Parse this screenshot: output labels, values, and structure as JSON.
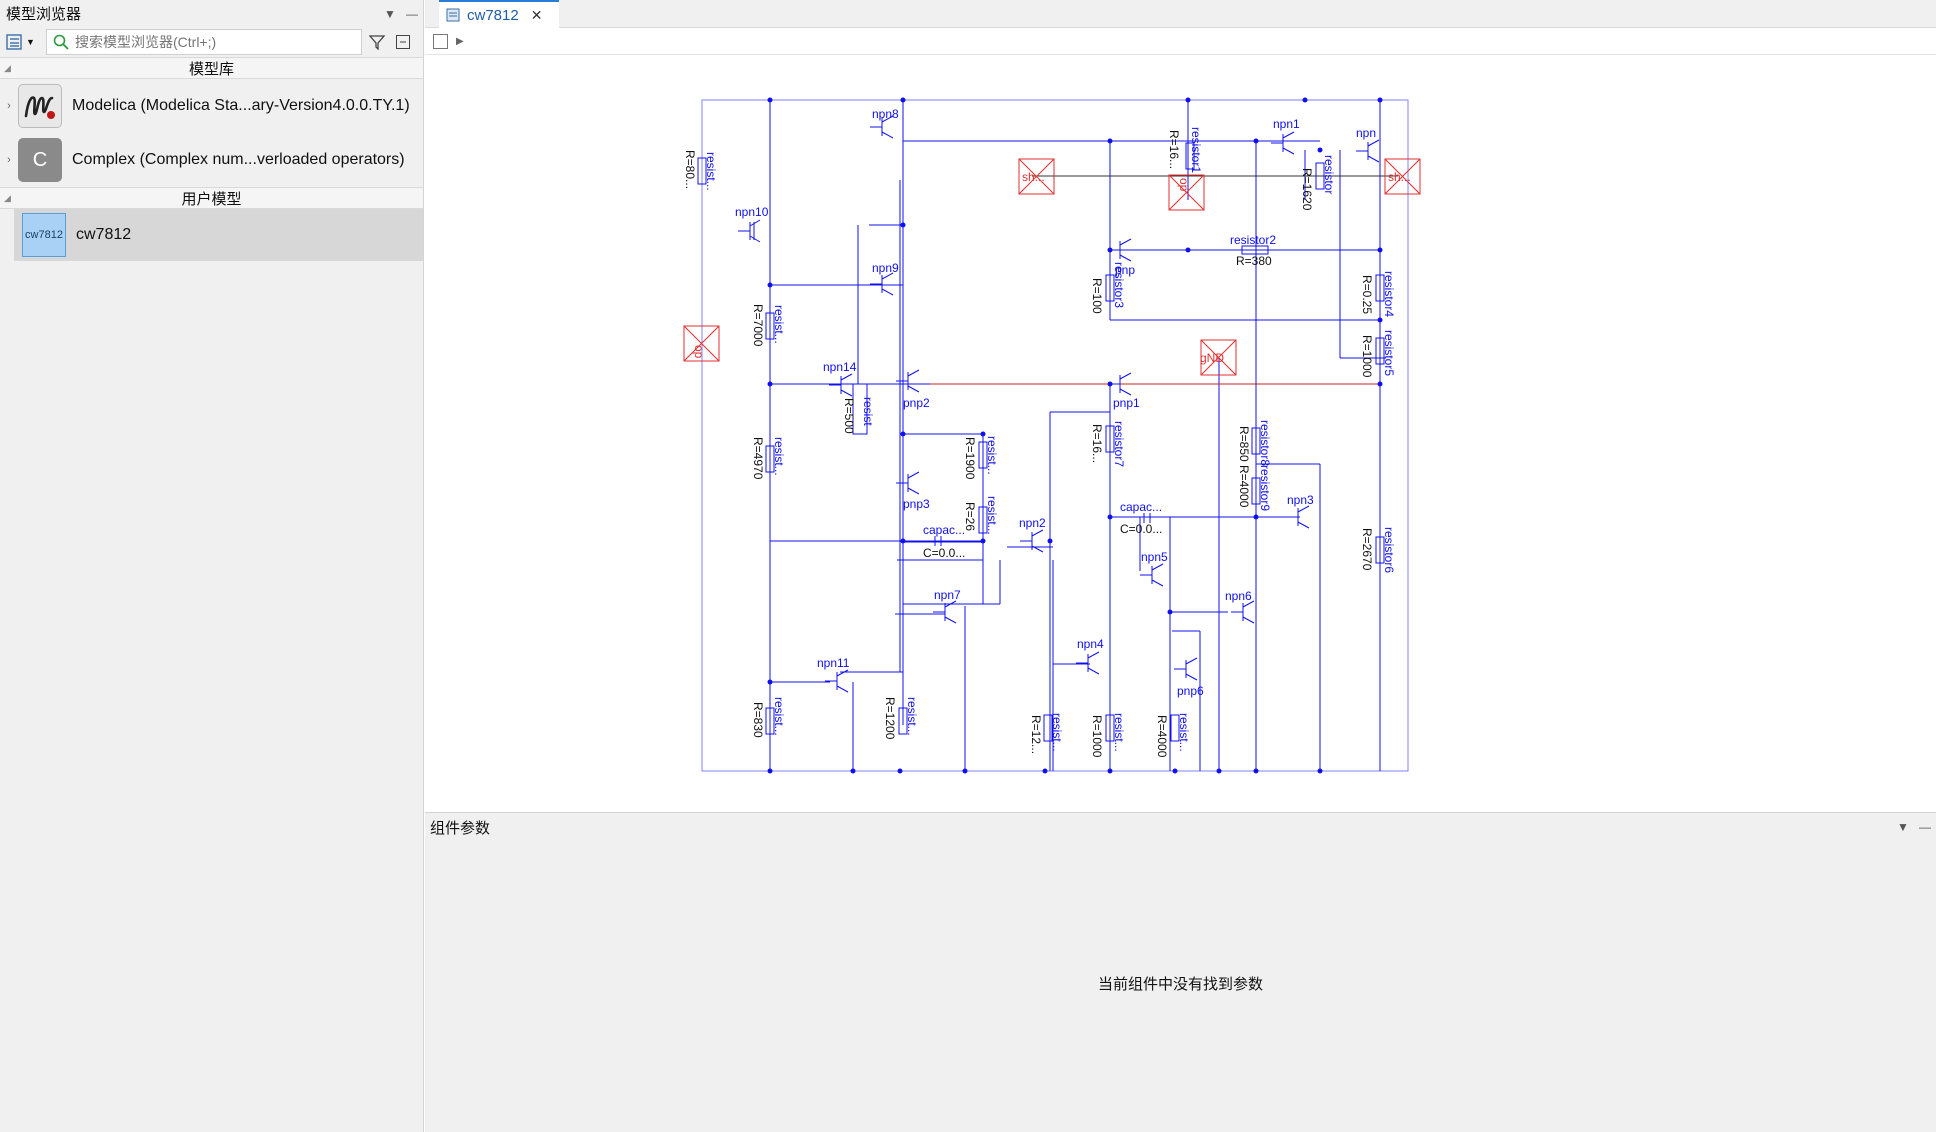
{
  "browser": {
    "title": "模型浏览器",
    "search_placeholder": "搜索模型浏览器(Ctrl+;)",
    "library_section": "模型库",
    "libraries": [
      {
        "icon": "modelica-logo-icon",
        "label": "Modelica (Modelica Sta...ary-Version4.0.0.TY.1)"
      },
      {
        "icon_text": "C",
        "label": "Complex (Complex num...verloaded operators)"
      }
    ],
    "user_section": "用户模型",
    "user_models": [
      {
        "icon_text": "cw7812",
        "label": "cw7812"
      }
    ]
  },
  "tab": {
    "label": "cw7812"
  },
  "params": {
    "title": "组件参数",
    "empty_message": "当前组件中没有找到参数"
  },
  "diagram": {
    "colors": {
      "wire": "#0000ff",
      "component": "#0000cc",
      "connector": "#e03030",
      "border": "#8080ff"
    },
    "labels": {
      "npn8": "npn8",
      "npn10": "npn10",
      "npn9": "npn9",
      "npn14": "npn14",
      "pnp2": "pnp2",
      "pnp3": "pnp3",
      "npn7": "npn7",
      "npn11": "npn11",
      "npn2": "npn2",
      "npn4": "npn4",
      "npn5": "npn5",
      "pnp6": "pnp6",
      "npn6": "npn6",
      "npn3": "npn3",
      "npn1": "npn1",
      "npn": "npn",
      "pnp": "pnp",
      "pnp1": "pnp1",
      "resistor1": "resistor1",
      "resistor2": "resistor2",
      "resistor3": "resistor3",
      "resistor4": "resistor4",
      "resistor5": "resistor5",
      "resistor6": "resistor6",
      "resistor7": "resistor7",
      "resistor8": "resistor8",
      "resistor9": "resistor9",
      "resistor": "resistor",
      "resist": "resist...",
      "resist_short": "resist",
      "capac": "capac...",
      "sh": "sh...",
      "op": "op",
      "gnd": "gND",
      "r80": "R=80...",
      "r16": "R=16...",
      "r1620": "R=1620",
      "r380": "R=380",
      "r100": "R=100",
      "r025": "R=0.25",
      "r1000": "R=1000",
      "r7000": "R=7000",
      "r500": "R=500",
      "r4970": "R=4970",
      "r1900": "R=1900",
      "r26": "R=26",
      "r850": "R=850",
      "r4000": "R=4000",
      "r2670": "R=2670",
      "r830": "R=830",
      "r1200": "R=1200",
      "r12": "R=12...",
      "c00": "C=0.0..."
    }
  }
}
